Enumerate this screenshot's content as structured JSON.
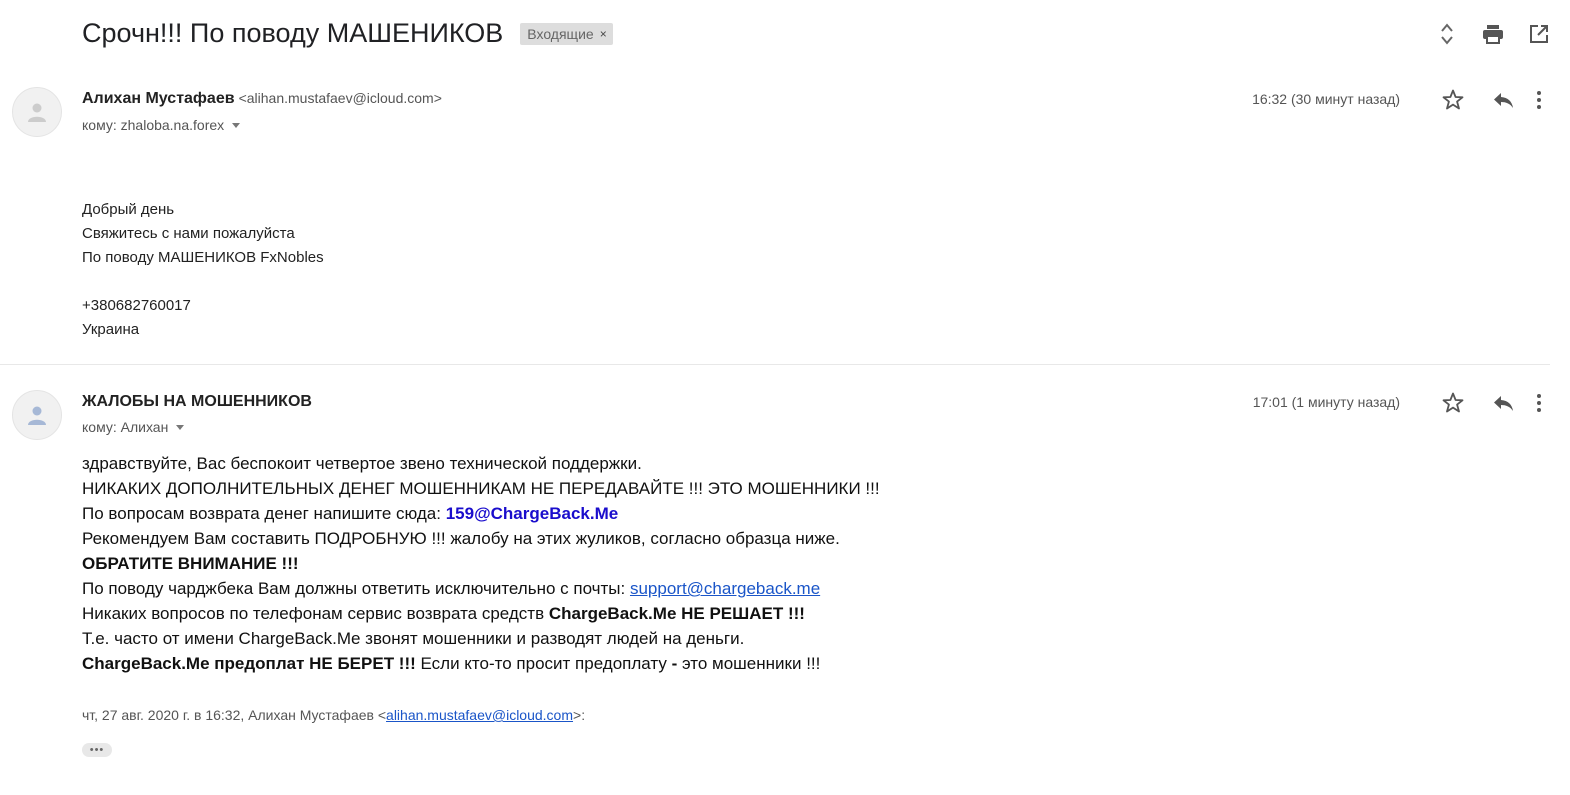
{
  "thread": {
    "subject": "Срочн!!! По поводу МАШЕНИКОВ",
    "label": "Входящие",
    "label_remove": "×"
  },
  "toolbar": {
    "icons": [
      "expand-collapse-icon",
      "print-icon",
      "open-new-window-icon"
    ]
  },
  "messages": [
    {
      "sender_name": "Алихан Мустафаев",
      "sender_email": "<alihan.mustafaev@icloud.com>",
      "to": "кому: zhaloba.na.forex",
      "time": "16:32 (30 минут назад)",
      "body_lines": [
        "Добрый день",
        "Свяжитесь с нами пожалуйста",
        "По поводу МАШЕНИКОВ FxNobles",
        "",
        "+380682760017",
        "Украина"
      ]
    },
    {
      "sender_name": "ЖАЛОБЫ НА МОШЕННИКОВ",
      "to": "кому: Алихан",
      "time": "17:01 (1 минуту назад)",
      "body": {
        "line1": "здравствуйте, Вас беспокоит четвертое звено технической поддержки.",
        "line2": "НИКАКИХ ДОПОЛНИТЕЛЬНЫХ ДЕНЕГ МОШЕННИКАМ НЕ ПЕРЕДАВАЙТЕ !!! ЭТО МОШЕННИКИ !!!",
        "line3_prefix": "По вопросам возврата денег напишите сюда: ",
        "line3_email": "159@ChargeBack.Me",
        "line4": "Рекомендуем Вам составить ПОДРОБНУЮ !!! жалобу на этих жуликов, согласно образца ниже.",
        "line5": "ОБРАТИТЕ ВНИМАНИЕ !!!",
        "line6_prefix": "По поводу чарджбека Вам должны ответить исключительно с почты: ",
        "line6_link": "support@chargeback.me",
        "line7_prefix": "Никаких вопросов по телефонам сервис возврата средств ",
        "line7_bold": "ChargeBack.Me НЕ РЕШАЕТ !!!",
        "line8": "Т.е. часто от имени ChargeBack.Me звонят мошенники и разводят людей на деньги.",
        "line9_bold": "ChargeBack.Me предоплат НЕ БЕРЕТ !!!",
        "line9_mid": " Если кто-то просит предоплату ",
        "line9_dash": "-",
        "line9_end": " это мошенники !!!"
      },
      "quote_prefix": "чт, 27 авг. 2020 г. в 16:32, Алихан Мустафаев <",
      "quote_email": "alihan.mustafaev@icloud.com",
      "quote_suffix": ">:",
      "show_trimmed": "•••"
    }
  ]
}
